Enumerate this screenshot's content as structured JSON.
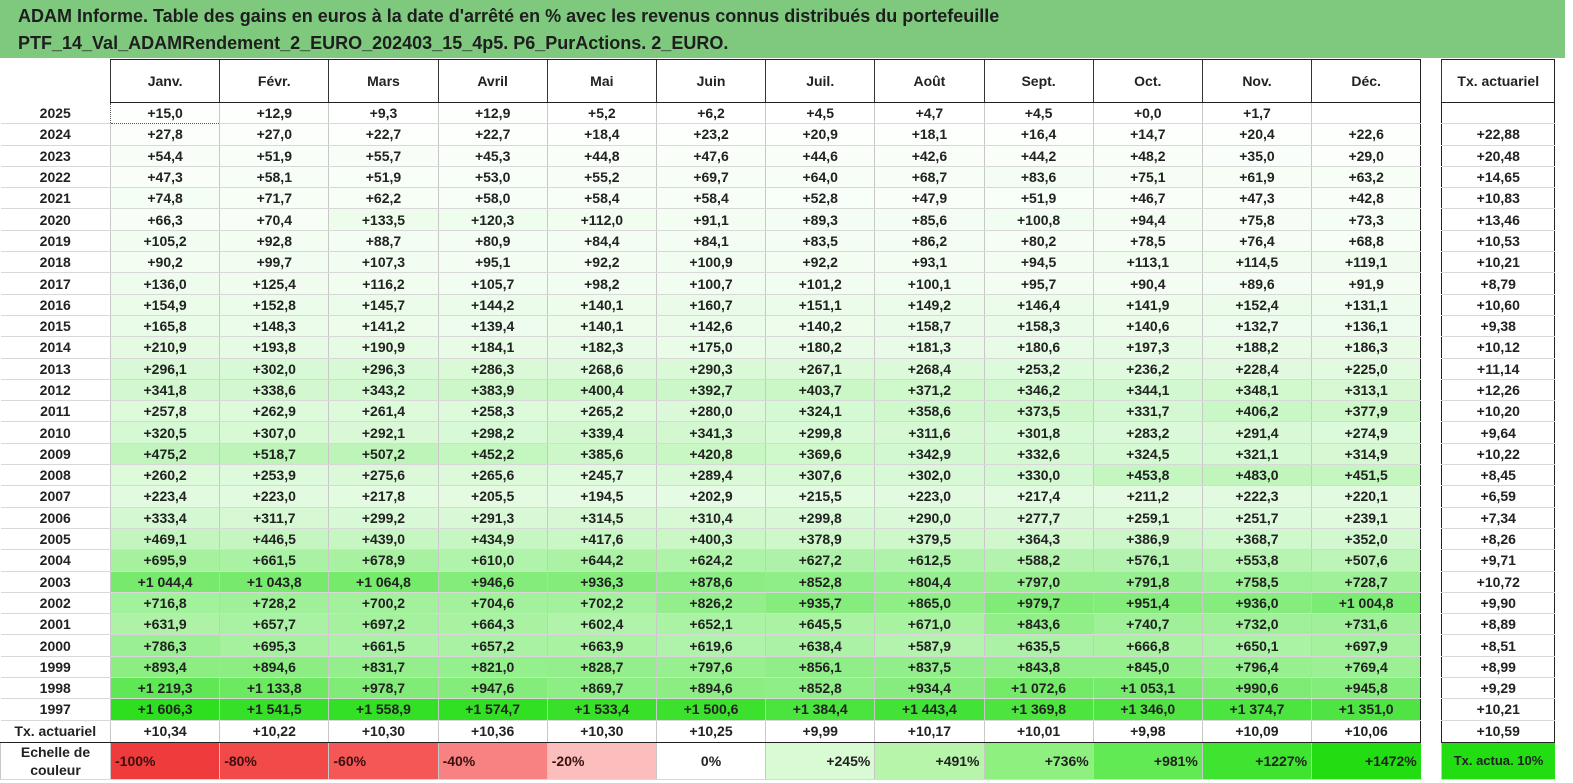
{
  "title": {
    "line1": "ADAM Informe. Table des gains en euros à la date d'arrêté en % avec les revenus connus distribués du portefeuille",
    "line2": "PTF_14_Val_ADAMRendement_2_EURO_202403_15_4p5. P6_PurActions. 2_EURO."
  },
  "table": {
    "months": [
      "Janv.",
      "Févr.",
      "Mars",
      "Avril",
      "Mai",
      "Juin",
      "Juil.",
      "Août",
      "Sept.",
      "Oct.",
      "Nov.",
      "Déc."
    ],
    "rate_header": "Tx. actuariel",
    "rows": [
      {
        "year": "2025",
        "values": [
          "+15,0",
          "+12,9",
          "+9,3",
          "+12,9",
          "+5,2",
          "+6,2",
          "+4,5",
          "+4,7",
          "+4,5",
          "+0,0",
          "+1,7",
          ""
        ],
        "rate": ""
      },
      {
        "year": "2024",
        "values": [
          "+27,8",
          "+27,0",
          "+22,7",
          "+22,7",
          "+18,4",
          "+23,2",
          "+20,9",
          "+18,1",
          "+16,4",
          "+14,7",
          "+20,4",
          "+22,6"
        ],
        "rate": "+22,88"
      },
      {
        "year": "2023",
        "values": [
          "+54,4",
          "+51,9",
          "+55,7",
          "+45,3",
          "+44,8",
          "+47,6",
          "+44,6",
          "+42,6",
          "+44,2",
          "+48,2",
          "+35,0",
          "+29,0"
        ],
        "rate": "+20,48"
      },
      {
        "year": "2022",
        "values": [
          "+47,3",
          "+58,1",
          "+51,9",
          "+53,0",
          "+55,2",
          "+69,7",
          "+64,0",
          "+68,7",
          "+83,6",
          "+75,1",
          "+61,9",
          "+63,2"
        ],
        "rate": "+14,65"
      },
      {
        "year": "2021",
        "values": [
          "+74,8",
          "+71,7",
          "+62,2",
          "+58,0",
          "+58,4",
          "+58,4",
          "+52,8",
          "+47,9",
          "+51,9",
          "+46,7",
          "+47,3",
          "+42,8"
        ],
        "rate": "+10,83"
      },
      {
        "year": "2020",
        "values": [
          "+66,3",
          "+70,4",
          "+133,5",
          "+120,3",
          "+112,0",
          "+91,1",
          "+89,3",
          "+85,6",
          "+100,8",
          "+94,4",
          "+75,8",
          "+73,3"
        ],
        "rate": "+13,46"
      },
      {
        "year": "2019",
        "values": [
          "+105,2",
          "+92,8",
          "+88,7",
          "+80,9",
          "+84,4",
          "+84,1",
          "+83,5",
          "+86,2",
          "+80,2",
          "+78,5",
          "+76,4",
          "+68,8"
        ],
        "rate": "+10,53"
      },
      {
        "year": "2018",
        "values": [
          "+90,2",
          "+99,7",
          "+107,3",
          "+95,1",
          "+92,2",
          "+100,9",
          "+92,2",
          "+93,1",
          "+94,5",
          "+113,1",
          "+114,5",
          "+119,1"
        ],
        "rate": "+10,21"
      },
      {
        "year": "2017",
        "values": [
          "+136,0",
          "+125,4",
          "+116,2",
          "+105,7",
          "+98,2",
          "+100,7",
          "+101,2",
          "+100,1",
          "+95,7",
          "+90,4",
          "+89,6",
          "+91,9"
        ],
        "rate": "+8,79"
      },
      {
        "year": "2016",
        "values": [
          "+154,9",
          "+152,8",
          "+145,7",
          "+144,2",
          "+140,1",
          "+160,7",
          "+151,1",
          "+149,2",
          "+146,4",
          "+141,9",
          "+152,4",
          "+131,1"
        ],
        "rate": "+10,60"
      },
      {
        "year": "2015",
        "values": [
          "+165,8",
          "+148,3",
          "+141,2",
          "+139,4",
          "+140,1",
          "+142,6",
          "+140,2",
          "+158,7",
          "+158,3",
          "+140,6",
          "+132,7",
          "+136,1"
        ],
        "rate": "+9,38"
      },
      {
        "year": "2014",
        "values": [
          "+210,9",
          "+193,8",
          "+190,9",
          "+184,1",
          "+182,3",
          "+175,0",
          "+180,2",
          "+181,3",
          "+180,6",
          "+197,3",
          "+188,2",
          "+186,3"
        ],
        "rate": "+10,12"
      },
      {
        "year": "2013",
        "values": [
          "+296,1",
          "+302,0",
          "+296,3",
          "+286,3",
          "+268,6",
          "+290,3",
          "+267,1",
          "+268,4",
          "+253,2",
          "+236,2",
          "+228,4",
          "+225,0"
        ],
        "rate": "+11,14"
      },
      {
        "year": "2012",
        "values": [
          "+341,8",
          "+338,6",
          "+343,2",
          "+383,9",
          "+400,4",
          "+392,7",
          "+403,7",
          "+371,2",
          "+346,2",
          "+344,1",
          "+348,1",
          "+313,1"
        ],
        "rate": "+12,26"
      },
      {
        "year": "2011",
        "values": [
          "+257,8",
          "+262,9",
          "+261,4",
          "+258,3",
          "+265,2",
          "+280,0",
          "+324,1",
          "+358,6",
          "+373,5",
          "+331,7",
          "+406,2",
          "+377,9"
        ],
        "rate": "+10,20"
      },
      {
        "year": "2010",
        "values": [
          "+320,5",
          "+307,0",
          "+292,1",
          "+298,2",
          "+339,4",
          "+341,3",
          "+299,8",
          "+311,6",
          "+301,8",
          "+283,2",
          "+291,4",
          "+274,9"
        ],
        "rate": "+9,64"
      },
      {
        "year": "2009",
        "values": [
          "+475,2",
          "+518,7",
          "+507,2",
          "+452,2",
          "+385,6",
          "+420,8",
          "+369,6",
          "+342,9",
          "+332,6",
          "+324,5",
          "+321,1",
          "+314,9"
        ],
        "rate": "+10,22"
      },
      {
        "year": "2008",
        "values": [
          "+260,2",
          "+253,9",
          "+275,6",
          "+265,6",
          "+245,7",
          "+289,4",
          "+307,6",
          "+302,0",
          "+330,0",
          "+453,8",
          "+483,0",
          "+451,5"
        ],
        "rate": "+8,45"
      },
      {
        "year": "2007",
        "values": [
          "+223,4",
          "+223,0",
          "+217,8",
          "+205,5",
          "+194,5",
          "+202,9",
          "+215,5",
          "+223,0",
          "+217,4",
          "+211,2",
          "+222,3",
          "+220,1"
        ],
        "rate": "+6,59"
      },
      {
        "year": "2006",
        "values": [
          "+333,4",
          "+311,7",
          "+299,2",
          "+291,3",
          "+314,5",
          "+310,4",
          "+299,8",
          "+290,0",
          "+277,7",
          "+259,1",
          "+251,7",
          "+239,1"
        ],
        "rate": "+7,34"
      },
      {
        "year": "2005",
        "values": [
          "+469,1",
          "+446,5",
          "+439,0",
          "+434,9",
          "+417,6",
          "+400,3",
          "+378,9",
          "+379,5",
          "+364,3",
          "+386,9",
          "+368,7",
          "+352,0"
        ],
        "rate": "+8,26"
      },
      {
        "year": "2004",
        "values": [
          "+695,9",
          "+661,5",
          "+678,9",
          "+610,0",
          "+644,2",
          "+624,2",
          "+627,2",
          "+612,5",
          "+588,2",
          "+576,1",
          "+553,8",
          "+507,6"
        ],
        "rate": "+9,71"
      },
      {
        "year": "2003",
        "values": [
          "+1 044,4",
          "+1 043,8",
          "+1 064,8",
          "+946,6",
          "+936,3",
          "+878,6",
          "+852,8",
          "+804,4",
          "+797,0",
          "+791,8",
          "+758,5",
          "+728,7"
        ],
        "rate": "+10,72"
      },
      {
        "year": "2002",
        "values": [
          "+716,8",
          "+728,2",
          "+700,2",
          "+704,6",
          "+702,2",
          "+826,2",
          "+935,7",
          "+865,0",
          "+979,7",
          "+951,4",
          "+936,0",
          "+1 004,8"
        ],
        "rate": "+9,90"
      },
      {
        "year": "2001",
        "values": [
          "+631,9",
          "+657,7",
          "+697,2",
          "+664,3",
          "+602,4",
          "+652,1",
          "+645,5",
          "+671,0",
          "+843,6",
          "+740,7",
          "+732,0",
          "+731,6"
        ],
        "rate": "+8,89"
      },
      {
        "year": "2000",
        "values": [
          "+786,3",
          "+695,3",
          "+661,5",
          "+657,2",
          "+663,9",
          "+619,6",
          "+638,4",
          "+587,9",
          "+635,5",
          "+666,8",
          "+650,1",
          "+697,9"
        ],
        "rate": "+8,51"
      },
      {
        "year": "1999",
        "values": [
          "+893,4",
          "+894,6",
          "+831,7",
          "+821,0",
          "+828,7",
          "+797,6",
          "+856,1",
          "+837,5",
          "+843,8",
          "+845,0",
          "+796,4",
          "+769,4"
        ],
        "rate": "+8,99"
      },
      {
        "year": "1998",
        "values": [
          "+1 219,3",
          "+1 133,8",
          "+978,7",
          "+947,6",
          "+869,7",
          "+894,6",
          "+852,8",
          "+934,4",
          "+1 072,6",
          "+1 053,1",
          "+990,6",
          "+945,8"
        ],
        "rate": "+9,29"
      },
      {
        "year": "1997",
        "values": [
          "+1 606,3",
          "+1 541,5",
          "+1 558,9",
          "+1 574,7",
          "+1 533,4",
          "+1 500,6",
          "+1 384,4",
          "+1 443,4",
          "+1 369,8",
          "+1 346,0",
          "+1 374,7",
          "+1 351,0"
        ],
        "rate": "+10,21"
      }
    ],
    "total_row": {
      "label": "Tx. actuariel",
      "values": [
        "+10,34",
        "+10,22",
        "+10,30",
        "+10,36",
        "+10,30",
        "+10,25",
        "+9,99",
        "+10,17",
        "+10,01",
        "+9,98",
        "+10,09",
        "+10,06"
      ],
      "rate": "+10,59"
    }
  },
  "legend": {
    "label": "Echelle de couleur",
    "steps": [
      "-100%",
      "-80%",
      "-60%",
      "-40%",
      "-20%",
      "0%",
      "+245%",
      "+491%",
      "+736%",
      "+981%",
      "+1227%",
      "+1472%"
    ],
    "step_colors": [
      "#ef3b3b",
      "#f24949",
      "#f55757",
      "#f88282",
      "#fcbdbd",
      "#ffffff",
      "#d9fbd3",
      "#b6f5aa",
      "#8df07f",
      "#62ea55",
      "#3fe431",
      "#22dd12"
    ],
    "rate_label": "Tx. actua. 10%",
    "rate_color": "#22dd12"
  },
  "colors": {
    "title_bg": "#7ec97e",
    "scale_max_color": "#22dd12"
  }
}
